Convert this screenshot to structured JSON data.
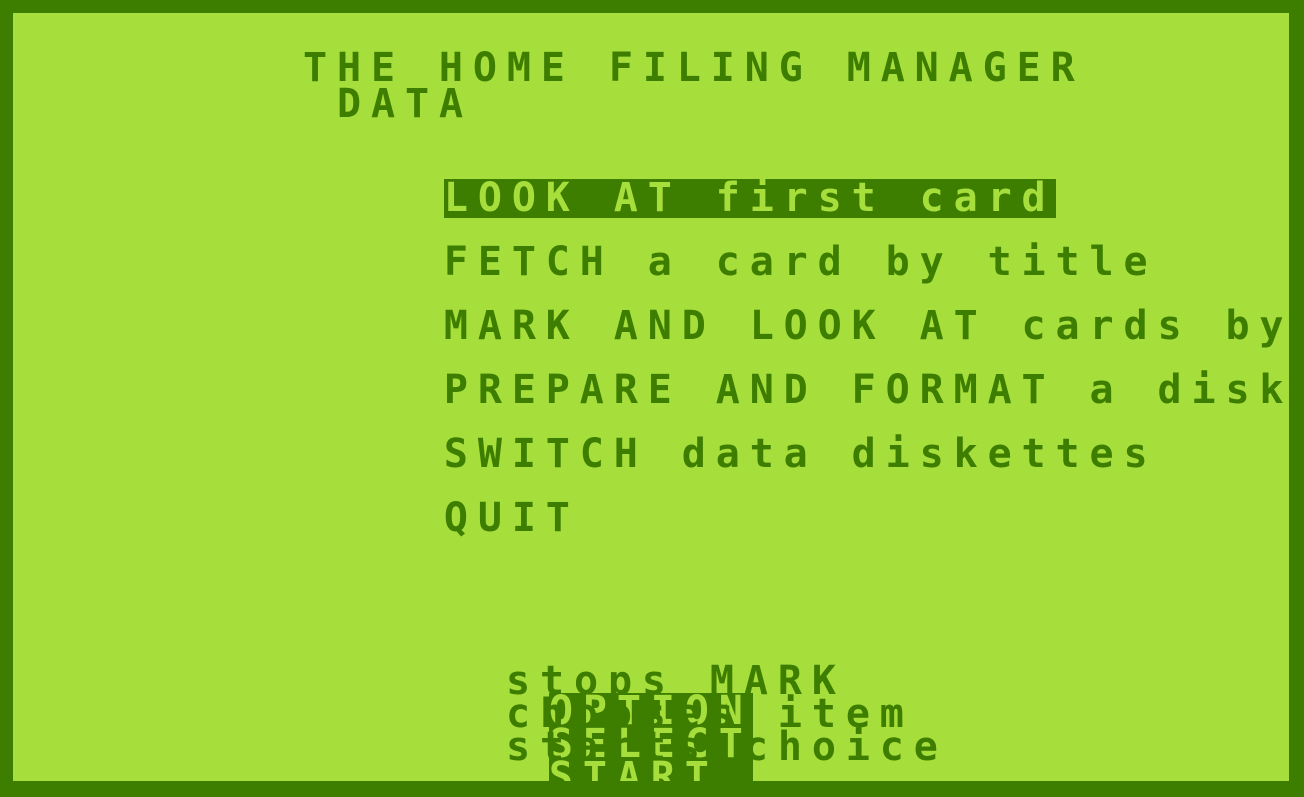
{
  "screen": {
    "border_color": "#3d7d00",
    "background_color": "#a6de3c",
    "text_color": "#3d7d00",
    "highlight_background": "#3d7d00",
    "highlight_text_color": "#a6de3c"
  },
  "title": {
    "line1": "THE HOME FILING MANAGER",
    "line2": "DATA"
  },
  "menu": {
    "selected_index": 0,
    "items": [
      {
        "label": "LOOK AT first card",
        "selected": true
      },
      {
        "label": "FETCH a card by title",
        "selected": false
      },
      {
        "label": "MARK AND LOOK AT cards by phrase",
        "selected": false
      },
      {
        "label": "PREPARE AND FORMAT a diskette",
        "selected": false
      },
      {
        "label": "SWITCH data diskettes",
        "selected": false
      },
      {
        "label": "QUIT",
        "selected": false
      }
    ]
  },
  "help": {
    "rows": [
      {
        "key": "OPTION",
        "description": "stops MARK"
      },
      {
        "key": "SELECT",
        "description": "chooses item"
      },
      {
        "key": "START ",
        "description": "starts choice"
      }
    ]
  }
}
